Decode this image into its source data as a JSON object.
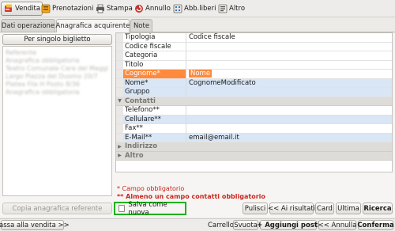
{
  "toolbar": {
    "items": [
      {
        "label": "Vendita",
        "icon": "vendita-icon"
      },
      {
        "label": "Prenotazioni",
        "icon": "prenotazioni-icon"
      },
      {
        "label": "Stampa",
        "icon": "stampa-icon"
      },
      {
        "label": "Annullo",
        "icon": "annullo-icon"
      },
      {
        "label": "Abb.liberi",
        "icon": "abb-liberi-icon"
      },
      {
        "label": "Altro",
        "icon": "altro-icon"
      }
    ]
  },
  "tabs": [
    "Dati operazione",
    "Anagrafica acquirente",
    "Note"
  ],
  "left": {
    "per_singolo_biglietto": "Per singolo biglietto",
    "copia_anagrafica": "Copia anagrafica referente",
    "blurred_entries": [
      "Referente",
      "Anagrafica obbligatoria",
      "Teatro Comunale Cara del Maggio",
      "Largo Piazza del Duomo 20/7",
      "Platea Fila H Posto 8/36",
      "Anagrafica obbligatoria"
    ]
  },
  "grid": {
    "fields": {
      "tipologia": {
        "label": "Tipologia",
        "value": "Codice fiscale"
      },
      "codice_fiscale": {
        "label": "Codice fiscale",
        "value": ""
      },
      "categoria": {
        "label": "Categoria",
        "value": ""
      },
      "titolo": {
        "label": "Titolo",
        "value": ""
      },
      "cognome": {
        "label": "Cognome*",
        "value": "Nome"
      },
      "nome": {
        "label": "Nome*",
        "value": "CognomeModificato"
      },
      "gruppo": {
        "label": "Gruppo",
        "value": ""
      },
      "telefono": {
        "label": "Telefono**",
        "value": ""
      },
      "cellulare": {
        "label": "Cellulare**",
        "value": ""
      },
      "fax": {
        "label": "Fax**",
        "value": ""
      },
      "email": {
        "label": "E-Mail**",
        "value": "email@email.it"
      }
    },
    "categories": {
      "contatti": "Contatti",
      "indirizzo": "Indirizzo",
      "altro": "Altro"
    }
  },
  "legend": {
    "obbligatorio": "* Campo obbligatorio",
    "contatti": "** Almeno un campo contatti obbligatorio"
  },
  "salva_come_nuova": {
    "label": "Salva come nuova",
    "checked": false
  },
  "actions": {
    "pulisci": "Pulisci",
    "ai_risultati": "<< Ai risultati",
    "card": "Card",
    "ultima": "Ultima",
    "ricerca": "Ricerca"
  },
  "bottom": {
    "passa_alla_vendita": "Passa alla vendita >>",
    "carrello": "Carrello",
    "svuota": "Svuota",
    "aggiungi_posti": "+ Aggiungi posti",
    "annulla": "<< Annulla",
    "conferma": "Conferma"
  },
  "colors": {
    "selected": "#ff8a3d",
    "row_highlight": "#d9e6f6",
    "required_text": "#c8261e",
    "focus_border": "#20b21d"
  }
}
